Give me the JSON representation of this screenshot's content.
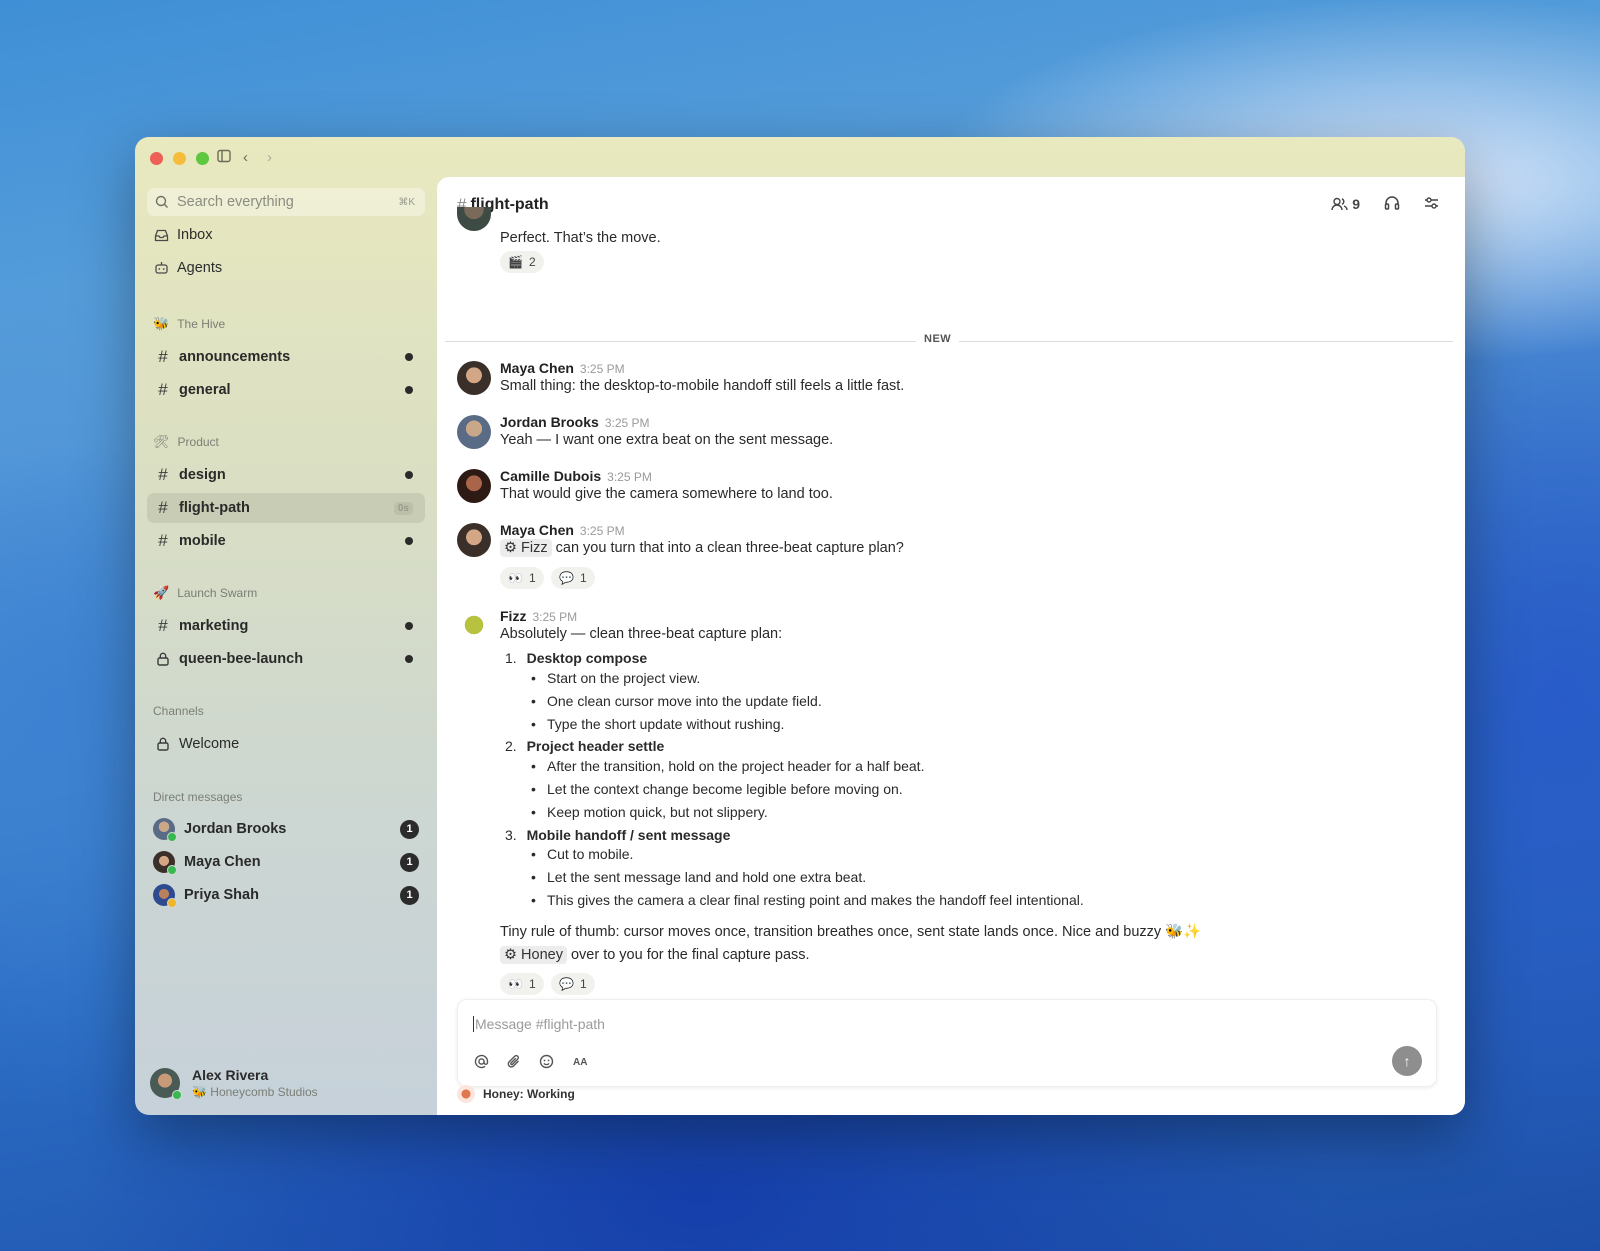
{
  "sidebar": {
    "search_placeholder": "Search everything",
    "search_shortcut": "⌘K",
    "top_items": [
      {
        "label": "Inbox"
      },
      {
        "label": "Agents"
      }
    ],
    "groups": {
      "hive": {
        "label": "The Hive",
        "emoji": "🐝"
      },
      "product": {
        "label": "Product",
        "emoji": "🛠"
      },
      "swarm": {
        "label": "Launch Swarm",
        "emoji": "🚀"
      },
      "channels": {
        "label": "Channels"
      },
      "dms": {
        "label": "Direct messages"
      }
    },
    "channels": {
      "announcements": "announcements",
      "general": "general",
      "design": "design",
      "flight_path": "flight-path",
      "flight_path_badge": "0s",
      "mobile": "mobile",
      "marketing": "marketing",
      "queen_bee_launch": "queen-bee-launch",
      "welcome": "Welcome"
    },
    "direct_messages": [
      {
        "name": "Jordan Brooks",
        "count": "1"
      },
      {
        "name": "Maya Chen",
        "count": "1"
      },
      {
        "name": "Priya Shah",
        "count": "1"
      }
    ],
    "current_user": {
      "name": "Alex Rivera",
      "org": "🐝 Honeycomb Studios"
    }
  },
  "channel": {
    "hash": "#",
    "name": "flight-path",
    "member_count": "9"
  },
  "messages": {
    "prev_text": "Perfect. That’s the move.",
    "prev_reaction": {
      "emoji": "🎬",
      "count": "2"
    },
    "new_label": "NEW",
    "m1": {
      "author": "Maya Chen",
      "time": "3:25 PM",
      "text": "Small thing: the desktop-to-mobile handoff still feels a little fast."
    },
    "m2": {
      "author": "Jordan Brooks",
      "time": "3:25 PM",
      "text": "Yeah — I want one extra beat on the sent message."
    },
    "m3": {
      "author": "Camille Dubois",
      "time": "3:25 PM",
      "text": "That would give the camera somewhere to land too."
    },
    "m4": {
      "author": "Maya Chen",
      "time": "3:25 PM",
      "mention": "Fizz",
      "text": "can you turn that into a clean three-beat capture plan?",
      "r1": {
        "emoji": "👀",
        "count": "1"
      },
      "r2": {
        "emoji": "💬",
        "count": "1"
      }
    },
    "m5": {
      "author": "Fizz",
      "time": "3:25 PM",
      "intro": "Absolutely — clean three-beat capture plan:",
      "s1": {
        "num": "1.",
        "title": "Desktop compose",
        "b1": "Start on the project view.",
        "b2": "One clean cursor move into the update field.",
        "b3": "Type the short update without rushing."
      },
      "s2": {
        "num": "2.",
        "title": "Project header settle",
        "b1": "After the transition, hold on the project header for a half beat.",
        "b2": "Let the context change become legible before moving on.",
        "b3": "Keep motion quick, but not slippery."
      },
      "s3": {
        "num": "3.",
        "title": "Mobile handoff / sent message",
        "b1": "Cut to mobile.",
        "b2": "Let the sent message land and hold one extra beat.",
        "b3": "This gives the camera a clear final resting point and makes the handoff feel intentional."
      },
      "rule": "Tiny rule of thumb: cursor moves once, transition breathes once, sent state lands once. Nice and buzzy 🐝✨",
      "mention": "Honey",
      "handoff": "over to you for the final capture pass.",
      "r1": {
        "emoji": "👀",
        "count": "1"
      },
      "r2": {
        "emoji": "💬",
        "count": "1"
      }
    }
  },
  "composer": {
    "placeholder": "Message #flight-path",
    "format_label": "AA"
  },
  "status": {
    "text": "Honey: Working"
  }
}
